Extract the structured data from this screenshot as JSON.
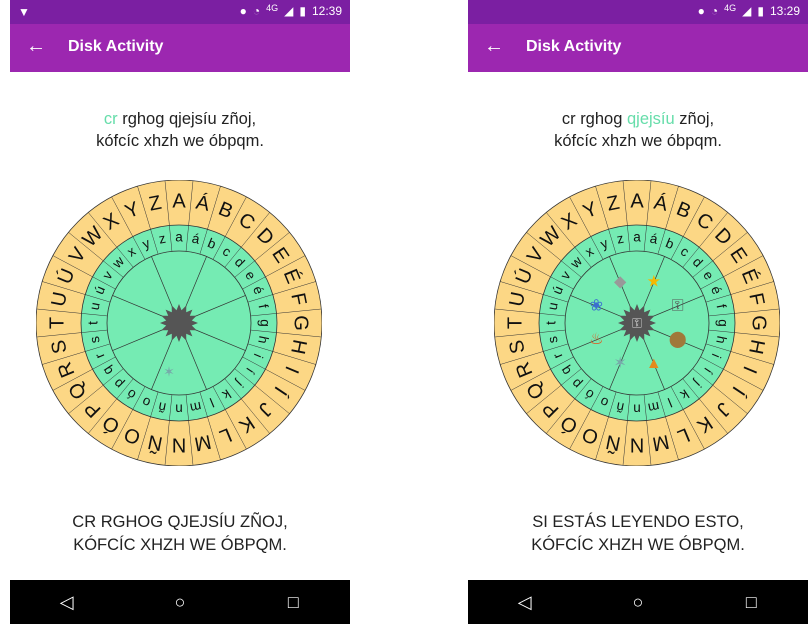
{
  "screens": [
    {
      "status": {
        "notification": "▼",
        "network": "4G",
        "time": "12:39"
      },
      "appbar": {
        "title": "Disk Activity",
        "back_icon": "arrow-left-icon"
      },
      "cipher": {
        "line1_parts": [
          {
            "text": "cr",
            "highlighted": true
          },
          {
            "text": " rghog qjejsíu zñoj,",
            "highlighted": false
          }
        ],
        "line2": "kófcíc xhzh we óbpqm."
      },
      "wheel": {
        "center_icons": [
          "moth-icon"
        ],
        "state": "hub-only"
      },
      "output": {
        "line1": "CR RGHOG QJEJSÍU ZÑOJ,",
        "line2": "KÓFCÍC XHZH WE ÓBPQM."
      }
    },
    {
      "status": {
        "notification": "",
        "network": "4G",
        "time": "13:29"
      },
      "appbar": {
        "title": "Disk Activity",
        "back_icon": "arrow-left-icon"
      },
      "cipher": {
        "line1_parts": [
          {
            "text": "cr rghog ",
            "highlighted": false
          },
          {
            "text": "qjejsíu",
            "highlighted": true
          },
          {
            "text": " zñoj,",
            "highlighted": false
          }
        ],
        "line2": "kófcíc xhzh we óbpqm."
      },
      "wheel": {
        "center_icons": [
          "bird-icon",
          "fish-icon",
          "star-icon",
          "key-icon",
          "nut-icon",
          "tent-icon",
          "moth-icon",
          "fire-icon"
        ],
        "state": "key-hub"
      },
      "output": {
        "line1": "SI ESTÁS LEYENDO ESTO,",
        "line2": "KÓFCÍC XHZH WE ÓBPQM."
      }
    }
  ],
  "alphabet": {
    "outer": [
      "A",
      "Á",
      "B",
      "C",
      "D",
      "E",
      "É",
      "F",
      "G",
      "H",
      "I",
      "Í",
      "J",
      "K",
      "L",
      "M",
      "N",
      "Ñ",
      "O",
      "Ó",
      "P",
      "Q",
      "R",
      "S",
      "T",
      "U",
      "Ú",
      "V",
      "W",
      "X",
      "Y",
      "Z"
    ],
    "inner": [
      "a",
      "á",
      "b",
      "c",
      "d",
      "e",
      "é",
      "f",
      "g",
      "h",
      "i",
      "í",
      "j",
      "k",
      "l",
      "m",
      "n",
      "ñ",
      "o",
      "ó",
      "p",
      "q",
      "r",
      "s",
      "t",
      "u",
      "ú",
      "v",
      "w",
      "x",
      "y",
      "z"
    ]
  },
  "navbar": {
    "back": "◁",
    "home": "○",
    "recents": "□"
  },
  "colors": {
    "statusbar": "#7b1fa2",
    "appbar": "#9c27b0",
    "outer_ring": "#fcd785",
    "inner_ring": "#75ebb3",
    "highlight": "#66ddaa",
    "hub": "#555555"
  }
}
